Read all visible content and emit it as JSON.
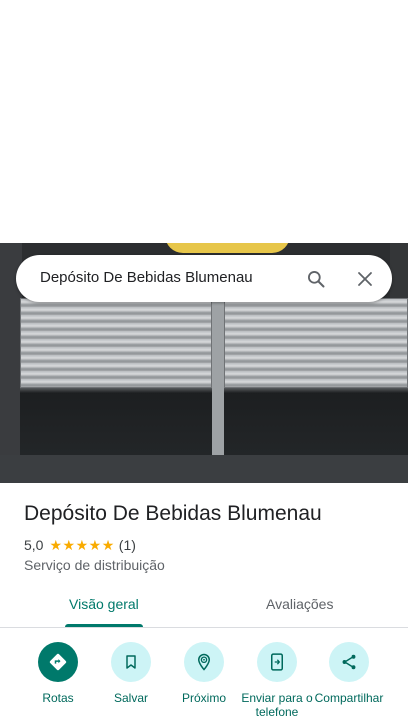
{
  "search": {
    "query": "Depósito De Bebidas Blumenau"
  },
  "place": {
    "name": "Depósito De Bebidas Blumenau",
    "rating": "5,0",
    "stars": 5,
    "review_count": "(1)",
    "category": "Serviço de distribuição"
  },
  "tabs": [
    {
      "label": "Visão geral",
      "active": true
    },
    {
      "label": "Avaliações",
      "active": false
    }
  ],
  "actions": [
    {
      "label": "Rotas",
      "icon": "directions-icon"
    },
    {
      "label": "Salvar",
      "icon": "bookmark-icon"
    },
    {
      "label": "Próximo",
      "icon": "nearby-icon"
    },
    {
      "label": "Enviar para o\ntelefone",
      "icon": "send-to-phone-icon"
    },
    {
      "label": "Compartilhar",
      "icon": "share-icon"
    }
  ],
  "colors": {
    "accent": "#00796b",
    "action_bg": "#cdf4f6",
    "star": "#f9ab00"
  }
}
